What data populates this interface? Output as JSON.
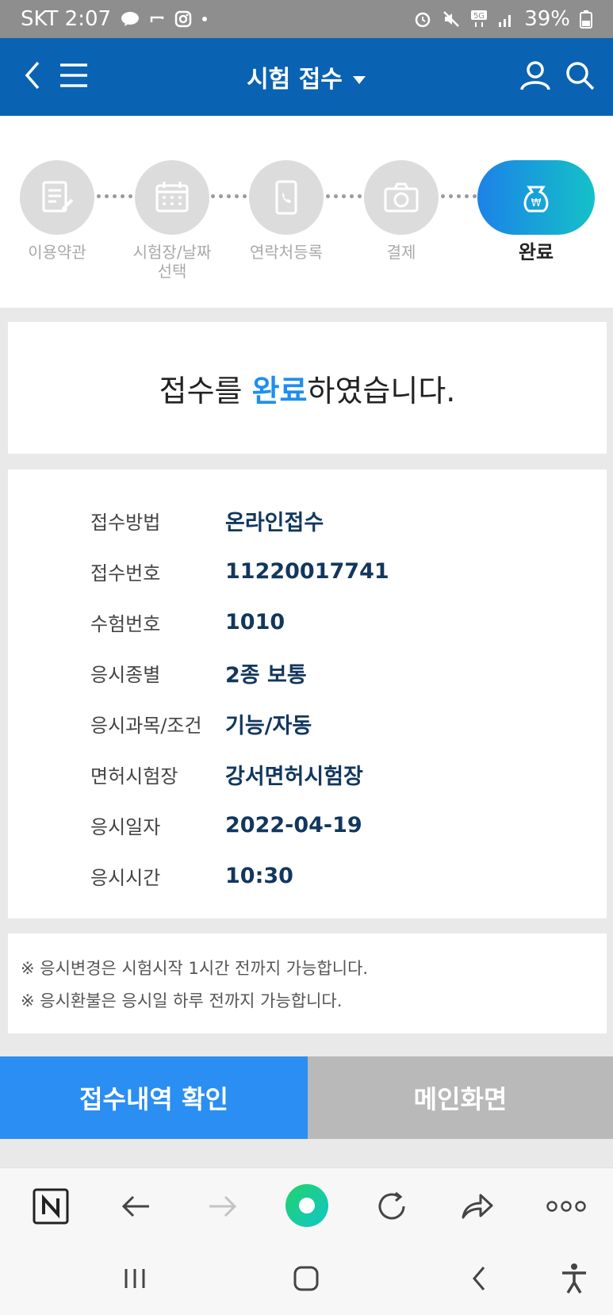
{
  "status_bar": {
    "carrier_time": "SKT 2:07",
    "battery": "39%",
    "net": "5G"
  },
  "header": {
    "title": "시험 접수"
  },
  "steps": [
    {
      "label": "이용약관",
      "icon": "document-edit-icon"
    },
    {
      "label": "시험장/날짜\n선택",
      "icon": "calendar-icon"
    },
    {
      "label": "연락처등록",
      "icon": "phone-icon"
    },
    {
      "label": "결제",
      "icon": "camera-icon"
    },
    {
      "label": "완료",
      "icon": "money-bag-icon",
      "active": true
    }
  ],
  "complete_message": {
    "before": "접수를 ",
    "highlight": "완료",
    "after": "하였습니다."
  },
  "info": [
    {
      "key": "접수방법",
      "value": "온라인접수"
    },
    {
      "key": "접수번호",
      "value": "11220017741"
    },
    {
      "key": "수험번호",
      "value": "1010"
    },
    {
      "key": "응시종별",
      "value": "2종 보통"
    },
    {
      "key": "응시과목/조건",
      "value": "기능/자동"
    },
    {
      "key": "면허시험장",
      "value": "강서면허시험장"
    },
    {
      "key": "응시일자",
      "value": "2022-04-19"
    },
    {
      "key": "응시시간",
      "value": "10:30"
    }
  ],
  "notes": [
    "※ 응시변경은 시험시작 1시간 전까지 가능합니다.",
    "※ 응시환불은 응시일 하루 전까지 가능합니다."
  ],
  "buttons": {
    "primary": "접수내역 확인",
    "secondary": "메인화면"
  },
  "colors": {
    "header": "#0a62b3",
    "accent": "#1e8ef0",
    "value": "#12375e"
  }
}
